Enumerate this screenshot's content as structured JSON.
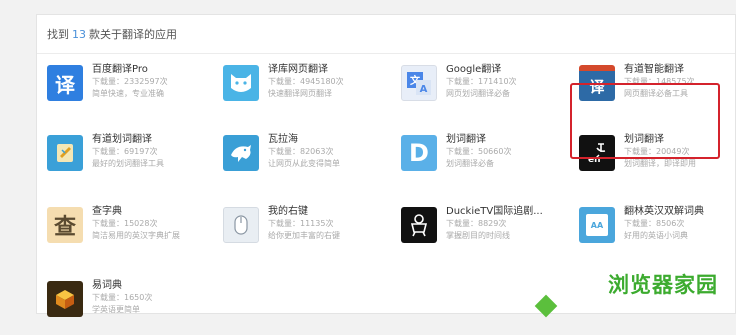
{
  "header": {
    "prefix": "找到",
    "count": "13",
    "suffix": "款关于翻译的应用"
  },
  "apps": [
    {
      "name": "百度翻译Pro",
      "downloads": "下载量：2332597次",
      "desc": "简单快速，专业准确",
      "icon": "yi-translate-icon",
      "glyph": "译",
      "color": "#2f7fe0"
    },
    {
      "name": "译库网页翻译",
      "downloads": "下载量：4945180次",
      "desc": "快速翻译网页翻译",
      "icon": "cat-face-icon",
      "glyph": "",
      "color": "#4ab4e6"
    },
    {
      "name": "Google翻译",
      "downloads": "下载量：171410次",
      "desc": "网页划词翻译必备",
      "icon": "google-translate-icon",
      "glyph": "",
      "color": "#4a86e8"
    },
    {
      "name": "有道智能翻译",
      "downloads": "下载量：148575次",
      "desc": "网页翻译必备工具",
      "icon": "youdao-translate-icon",
      "glyph": "译",
      "color": "#2d6aa6"
    },
    {
      "name": "有道划词翻译",
      "downloads": "下载量：69197次",
      "desc": "最好的划词翻译工具",
      "icon": "notebook-icon",
      "glyph": "",
      "color": "#3aa0d8"
    },
    {
      "name": "瓦拉海",
      "downloads": "下载量：82063次",
      "desc": "让网页从此变得简单",
      "icon": "dolphin-icon",
      "glyph": "",
      "color": "#3a9fd6"
    },
    {
      "name": "划词翻译",
      "downloads": "下载量：50660次",
      "desc": "划词翻译必备",
      "icon": "letter-d-icon",
      "glyph": "D",
      "color": "#5ab0e8"
    },
    {
      "name": "划词翻译",
      "downloads": "下载量：20049次",
      "desc": "划词翻译，即译即用",
      "icon": "translate-en-icon",
      "glyph": "",
      "color": "#111111"
    },
    {
      "name": "查字典",
      "downloads": "下载量：15028次",
      "desc": "简洁易用的英汉字典扩展",
      "icon": "cha-dictionary-icon",
      "glyph": "查",
      "color": "#f5ddb0"
    },
    {
      "name": "我的右键",
      "downloads": "下载量：11135次",
      "desc": "给你更加丰富的右键",
      "icon": "mouse-icon",
      "glyph": "",
      "color": "#e9eef3"
    },
    {
      "name": "DuckieTV国际追剧...",
      "downloads": "下载量：8829次",
      "desc": "掌握剧目的时间线",
      "icon": "duckie-icon",
      "glyph": "",
      "color": "#111111"
    },
    {
      "name": "翻林英汉双解词典",
      "downloads": "下载量：8506次",
      "desc": "好用的英语小词典",
      "icon": "dictionary-book-icon",
      "glyph": "AA",
      "color": "#4aa6dc"
    },
    {
      "name": "易词典",
      "downloads": "下载量：1650次",
      "desc": "学英语更简单",
      "icon": "cube-icon",
      "glyph": "",
      "color": "#e0a020"
    }
  ],
  "watermark": "浏览器家园"
}
